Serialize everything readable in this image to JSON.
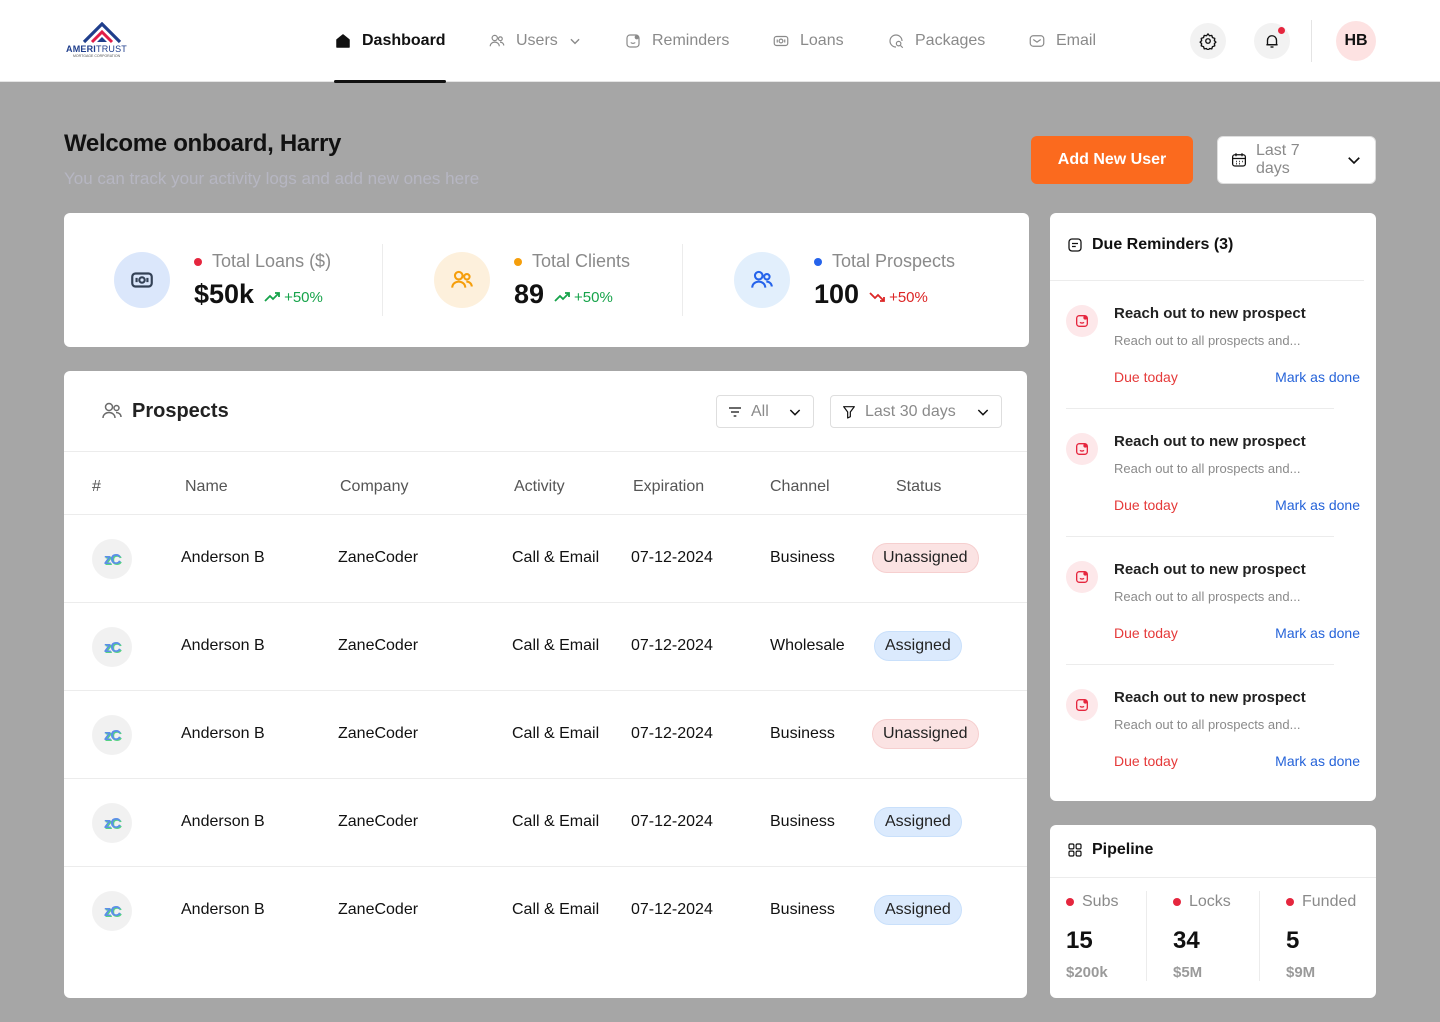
{
  "brand": {
    "name_bold": "AMERI",
    "name_light": "TRUST",
    "tagline": "MORTGAGE CORPORATION"
  },
  "nav": {
    "items": [
      {
        "label": "Dashboard",
        "icon": "home-icon",
        "active": true
      },
      {
        "label": "Users",
        "icon": "users-icon",
        "dropdown": true
      },
      {
        "label": "Reminders",
        "icon": "reminder-icon"
      },
      {
        "label": "Loans",
        "icon": "loan-icon"
      },
      {
        "label": "Packages",
        "icon": "package-icon"
      },
      {
        "label": "Email",
        "icon": "mail-icon"
      }
    ],
    "user_initials": "HB"
  },
  "welcome": {
    "title": "Welcome onboard, Harry",
    "subtitle": "You can track your activity logs and add new ones here",
    "add_user_label": "Add New User",
    "date_range": "Last 7 days"
  },
  "stats": [
    {
      "label": "Total Loans ($)",
      "value": "$50k",
      "change": "+50%",
      "trend": "up",
      "dot_color": "#e5263e",
      "icon": "loan-icon",
      "circle_bg": "#dbe7fb",
      "icon_color": "#334155"
    },
    {
      "label": "Total Clients",
      "value": "89",
      "change": "+50%",
      "trend": "up",
      "dot_color": "#f59e0b",
      "icon": "users-icon",
      "circle_bg": "#fdf0dc",
      "icon_color": "#f59e0b"
    },
    {
      "label": "Total Prospects",
      "value": "100",
      "change": "+50%",
      "trend": "down",
      "dot_color": "#2563eb",
      "icon": "users-icon",
      "circle_bg": "#e2effc",
      "icon_color": "#2563eb"
    }
  ],
  "prospects": {
    "title": "Prospects",
    "filter_label": "All",
    "range_label": "Last 30 days",
    "columns": [
      "#",
      "Name",
      "Company",
      "Activity",
      "Expiration",
      "Channel",
      "Status"
    ],
    "rows": [
      {
        "logo": "zC",
        "name": "Anderson B",
        "company": "ZaneCoder",
        "activity": "Call & Email",
        "expiration": "07-12-2024",
        "channel": "Business",
        "status": "Unassigned"
      },
      {
        "logo": "zC",
        "name": "Anderson B",
        "company": "ZaneCoder",
        "activity": "Call & Email",
        "expiration": "07-12-2024",
        "channel": "Wholesale",
        "status": "Assigned"
      },
      {
        "logo": "zC",
        "name": "Anderson B",
        "company": "ZaneCoder",
        "activity": "Call & Email",
        "expiration": "07-12-2024",
        "channel": "Business",
        "status": "Unassigned"
      },
      {
        "logo": "zC",
        "name": "Anderson B",
        "company": "ZaneCoder",
        "activity": "Call & Email",
        "expiration": "07-12-2024",
        "channel": "Business",
        "status": "Assigned"
      },
      {
        "logo": "zC",
        "name": "Anderson B",
        "company": "ZaneCoder",
        "activity": "Call & Email",
        "expiration": "07-12-2024",
        "channel": "Business",
        "status": "Assigned"
      }
    ]
  },
  "reminders": {
    "title": "Due Reminders (3)",
    "items": [
      {
        "title": "Reach out to new prospect",
        "desc": "Reach out to all prospects and...",
        "due": "Due today",
        "action": "Mark as done"
      },
      {
        "title": "Reach out to new prospect",
        "desc": "Reach out to all prospects and...",
        "due": "Due today",
        "action": "Mark as done"
      },
      {
        "title": "Reach out to new prospect",
        "desc": "Reach out to all prospects and...",
        "due": "Due today",
        "action": "Mark as done"
      },
      {
        "title": "Reach out to new prospect",
        "desc": "Reach out to all prospects and...",
        "due": "Due today",
        "action": "Mark as done"
      }
    ]
  },
  "pipeline": {
    "title": "Pipeline",
    "items": [
      {
        "label": "Subs",
        "value": "15",
        "amount": "$200k"
      },
      {
        "label": "Locks",
        "value": "34",
        "amount": "$5M"
      },
      {
        "label": "Funded",
        "value": "5",
        "amount": "$9M"
      }
    ],
    "dot_color": "#e5263e"
  },
  "colors": {
    "accent": "#fb6a1e",
    "link": "#2563d9",
    "danger": "#e53939",
    "up": "#16a34a",
    "down": "#dc2626"
  }
}
